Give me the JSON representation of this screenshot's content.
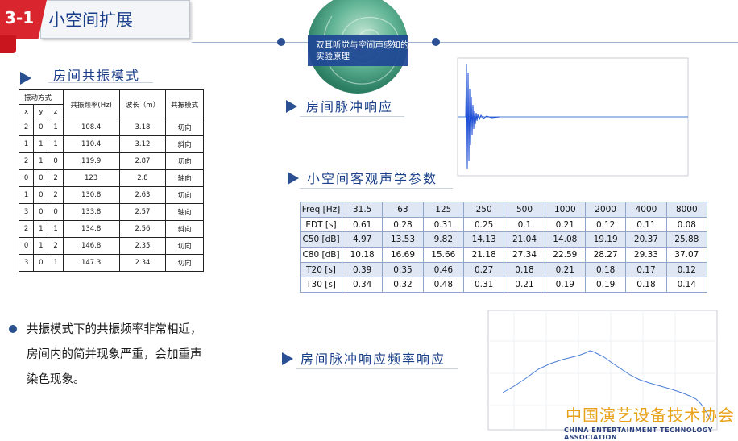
{
  "header": {
    "number": "3-1",
    "title": "小空间扩展"
  },
  "badge": {
    "text": "双耳听觉与空间声感知的实验原理"
  },
  "sections": {
    "modes": "房间共振模式",
    "impulse": "房间脉冲响应",
    "params": "小空间客观声学参数",
    "freqresp": "房间脉冲响应频率响应"
  },
  "mode_table": {
    "headers": [
      "振动方式",
      "共振频率(Hz)",
      "波长（m）",
      "共振模式"
    ],
    "subheaders": [
      "x",
      "y",
      "z"
    ],
    "rows": [
      [
        "2",
        "0",
        "1",
        "108.4",
        "3.18",
        "切向"
      ],
      [
        "1",
        "1",
        "1",
        "110.4",
        "3.12",
        "斜向"
      ],
      [
        "2",
        "1",
        "0",
        "119.9",
        "2.87",
        "切向"
      ],
      [
        "0",
        "0",
        "2",
        "123",
        "2.8",
        "轴向"
      ],
      [
        "1",
        "0",
        "2",
        "130.8",
        "2.63",
        "切向"
      ],
      [
        "3",
        "0",
        "0",
        "133.8",
        "2.57",
        "轴向"
      ],
      [
        "2",
        "1",
        "1",
        "134.8",
        "2.56",
        "斜向"
      ],
      [
        "0",
        "1",
        "2",
        "146.8",
        "2.35",
        "切向"
      ],
      [
        "3",
        "0",
        "1",
        "147.3",
        "2.34",
        "切向"
      ]
    ]
  },
  "param_table": {
    "rows": [
      [
        "Freq [Hz]",
        "31.5",
        "63",
        "125",
        "250",
        "500",
        "1000",
        "2000",
        "4000",
        "8000"
      ],
      [
        "EDT [s]",
        "0.61",
        "0.28",
        "0.31",
        "0.25",
        "0.1",
        "0.21",
        "0.12",
        "0.11",
        "0.08"
      ],
      [
        "C50 [dB]",
        "4.97",
        "13.53",
        "9.82",
        "14.13",
        "21.04",
        "14.08",
        "19.19",
        "20.37",
        "25.88"
      ],
      [
        "C80 [dB]",
        "10.18",
        "16.69",
        "15.66",
        "21.18",
        "27.34",
        "22.59",
        "28.27",
        "29.33",
        "37.07"
      ],
      [
        "T20 [s]",
        "0.39",
        "0.35",
        "0.46",
        "0.27",
        "0.18",
        "0.21",
        "0.18",
        "0.17",
        "0.12"
      ],
      [
        "T30 [s]",
        "0.34",
        "0.32",
        "0.48",
        "0.31",
        "0.21",
        "0.19",
        "0.19",
        "0.18",
        "0.14"
      ]
    ]
  },
  "bullet": {
    "lines": [
      "共振模式下的共振频率非常相近，",
      "房间内的简并现象严重，会加重声",
      "染色现象。"
    ]
  },
  "footer": {
    "cn": "中国演艺设备技术协会",
    "en": "CHINA ENTERTAINMENT TECHNOLOGY ASSOCIATION"
  },
  "colors": {
    "accent": "#2a4f92",
    "title": "#1a3f8a",
    "red": "#d9262e",
    "footer": "#e8a21a"
  }
}
